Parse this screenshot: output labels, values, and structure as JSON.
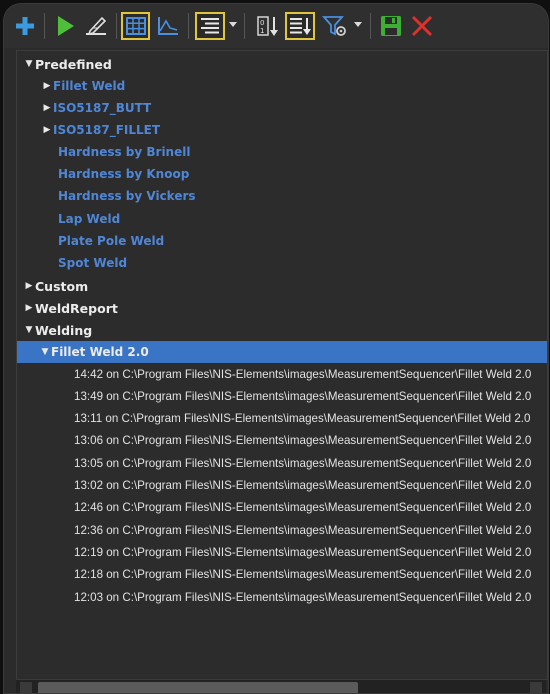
{
  "toolbar": {
    "icons": [
      "add-icon",
      "run-icon",
      "edit-icon",
      "grid-icon",
      "graph-icon",
      "list-view-icon",
      "dropdown-arrow-icon",
      "sort-numeric-icon",
      "sort-list-icon",
      "filter-settings-icon",
      "dropdown-arrow-icon",
      "save-icon",
      "close-icon"
    ]
  },
  "tree": {
    "predefined": {
      "label": "Predefined",
      "items": [
        {
          "label": "Fillet Weld",
          "has_children": true
        },
        {
          "label": "ISO5187_BUTT",
          "has_children": true
        },
        {
          "label": "ISO5187_FILLET",
          "has_children": true
        },
        {
          "label": "Hardness by Brinell",
          "has_children": false
        },
        {
          "label": "Hardness by Knoop",
          "has_children": false
        },
        {
          "label": "Hardness by Vickers",
          "has_children": false
        },
        {
          "label": "Lap Weld",
          "has_children": false
        },
        {
          "label": "Plate Pole Weld",
          "has_children": false
        },
        {
          "label": "Spot Weld",
          "has_children": false
        }
      ]
    },
    "custom": {
      "label": "Custom"
    },
    "weldreport": {
      "label": "WeldReport"
    },
    "welding": {
      "label": "Welding",
      "selected": {
        "label": "Fillet Weld 2.0"
      },
      "history": [
        "14:42 on C:\\Program Files\\NIS-Elements\\images\\MeasurementSequencer\\Fillet Weld 2.0",
        "13:49 on C:\\Program Files\\NIS-Elements\\images\\MeasurementSequencer\\Fillet Weld 2.0",
        "13:11 on C:\\Program Files\\NIS-Elements\\images\\MeasurementSequencer\\Fillet Weld 2.0",
        "13:06 on C:\\Program Files\\NIS-Elements\\images\\MeasurementSequencer\\Fillet Weld 2.0",
        "13:05 on C:\\Program Files\\NIS-Elements\\images\\MeasurementSequencer\\Fillet Weld 2.0",
        "13:02 on C:\\Program Files\\NIS-Elements\\images\\MeasurementSequencer\\Fillet Weld 2.0",
        "12:46 on C:\\Program Files\\NIS-Elements\\images\\MeasurementSequencer\\Fillet Weld 2.0",
        "12:36 on C:\\Program Files\\NIS-Elements\\images\\MeasurementSequencer\\Fillet Weld 2.0",
        "12:19 on C:\\Program Files\\NIS-Elements\\images\\MeasurementSequencer\\Fillet Weld 2.0",
        "12:18 on C:\\Program Files\\NIS-Elements\\images\\MeasurementSequencer\\Fillet Weld 2.0",
        "12:03 on C:\\Program Files\\NIS-Elements\\images\\MeasurementSequencer\\Fillet Weld 2.0"
      ]
    }
  },
  "colors": {
    "selection": "#3a74c4",
    "predefined_item": "#4f86d6",
    "toolbar_highlight": "#e0c640",
    "run_green": "#4fbf3a",
    "close_red": "#e0302a"
  }
}
